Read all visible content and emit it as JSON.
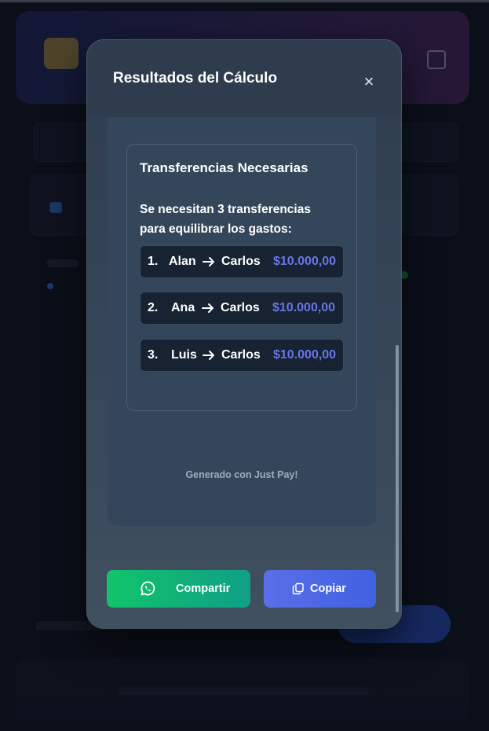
{
  "modal": {
    "title": "Resultados del Cálculo",
    "close_icon": "close-icon"
  },
  "transfers": {
    "title": "Transferencias Necesarias",
    "summary": "Se necesitan 3 transferencias para equilibrar los gastos:",
    "items": [
      {
        "index": "1.",
        "from": "Alan",
        "to": "Carlos",
        "amount": "$10.000,00"
      },
      {
        "index": "2.",
        "from": "Ana",
        "to": "Carlos",
        "amount": "$10.000,00"
      },
      {
        "index": "3.",
        "from": "Luis",
        "to": "Carlos",
        "amount": "$10.000,00"
      }
    ]
  },
  "footer": {
    "generated_by": "Generado con Just Pay!"
  },
  "actions": {
    "share_label": "Compartir",
    "share_icon": "whatsapp-icon",
    "copy_label": "Copiar",
    "copy_icon": "copy-icon"
  },
  "colors": {
    "share": "#11c46a",
    "copy": "#4f66e4",
    "amount": "#6b74e6",
    "modal_bg": "#34465a"
  }
}
